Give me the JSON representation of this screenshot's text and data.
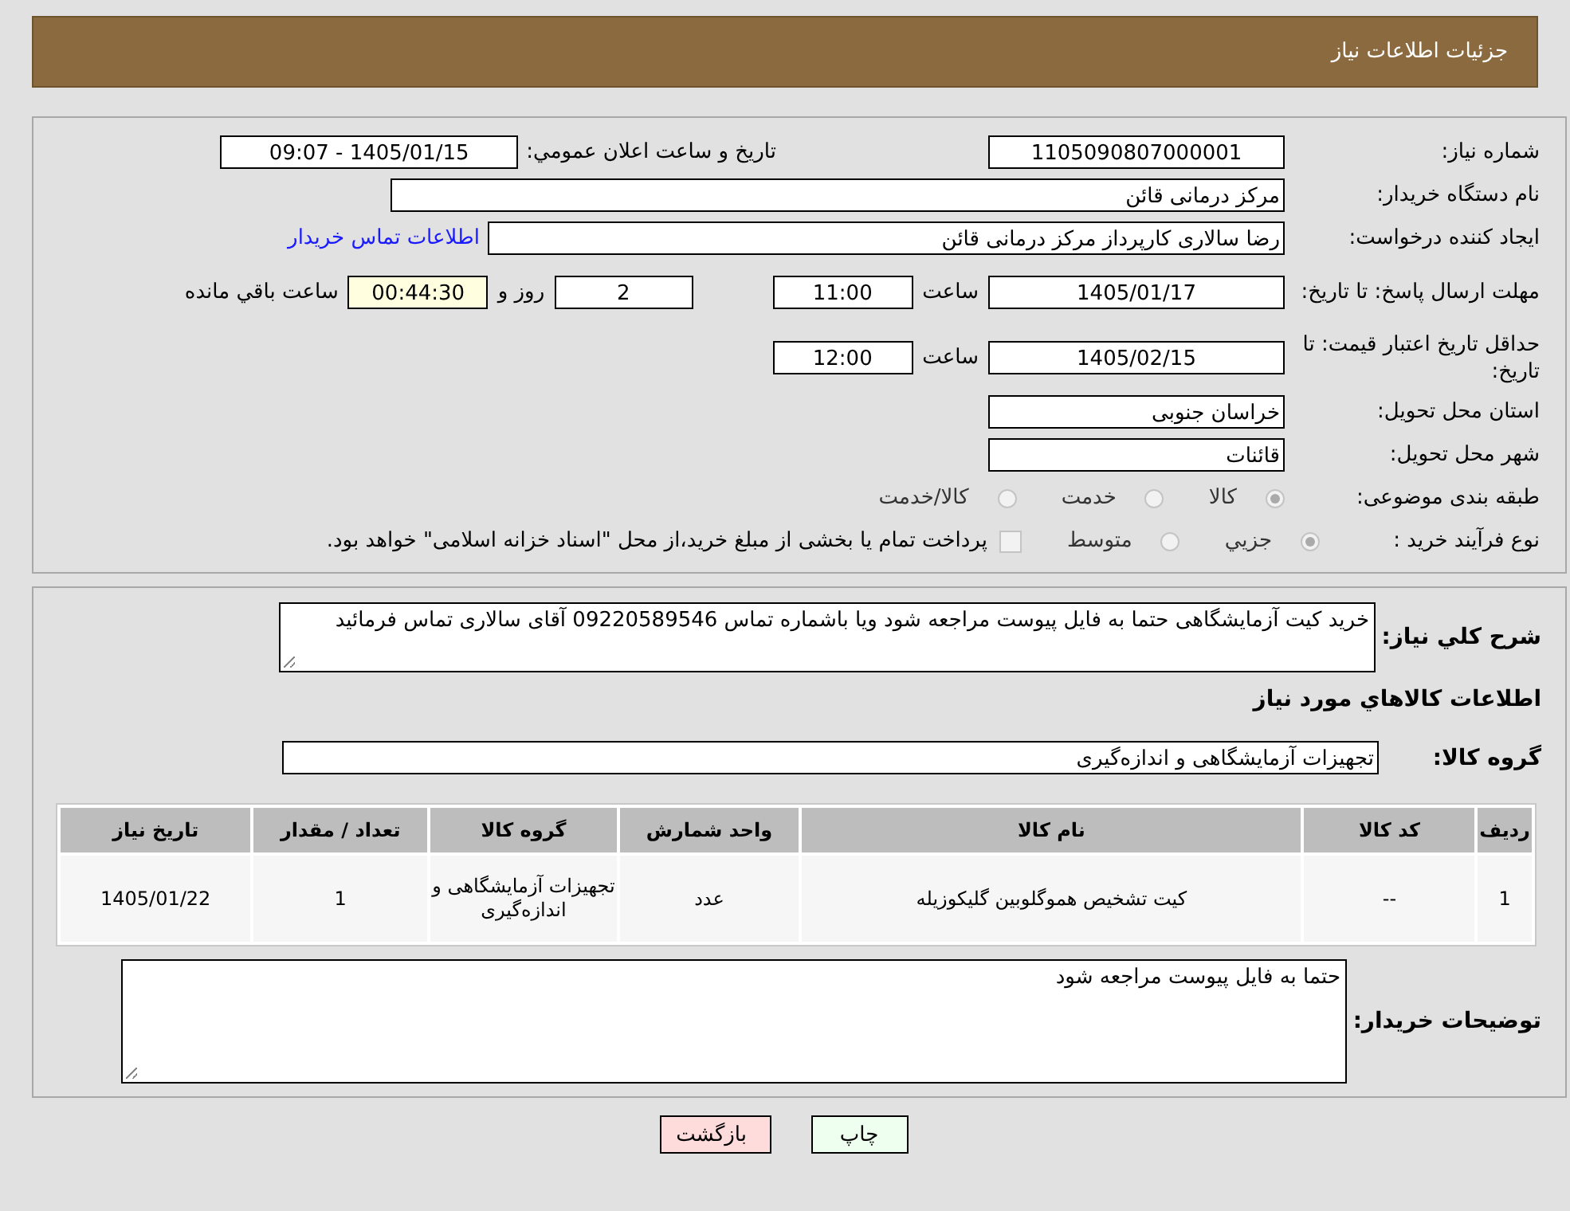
{
  "header": {
    "title": "جزئیات اطلاعات نیاز"
  },
  "details": {
    "need_number": {
      "label": "شماره نیاز:",
      "value": "1105090807000001"
    },
    "announce": {
      "label": "تاريخ و ساعت اعلان عمومي:",
      "value": "1405/01/15 - 09:07"
    },
    "buyer": {
      "label": "نام دستگاه خریدار:",
      "value": "مرکز درمانی قائن"
    },
    "creator": {
      "label": "ایجاد کننده درخواست:",
      "value": "رضا سالاری کارپرداز مرکز درمانی قائن",
      "link": "اطلاعات تماس خریدار"
    },
    "deadline": {
      "label": "مهلت ارسال پاسخ: تا تاریخ:",
      "date": "1405/01/17",
      "time_label": "ساعت",
      "time": "11:00",
      "days": "2",
      "days_label": "روز و",
      "remaining": "00:44:30",
      "remaining_label": "ساعت باقي مانده"
    },
    "validity": {
      "label": "حداقل تاریخ اعتبار قیمت: تا تاریخ:",
      "date": "1405/02/15",
      "time_label": "ساعت",
      "time": "12:00"
    },
    "province": {
      "label": "استان محل تحویل:",
      "value": "خراسان جنوبی"
    },
    "city": {
      "label": "شهر محل تحویل:",
      "value": "قائنات"
    },
    "category": {
      "label": "طبقه بندی موضوعی:",
      "options": [
        {
          "label": "کالا",
          "selected": true,
          "disabled": true
        },
        {
          "label": "خدمت",
          "selected": false,
          "disabled": true
        },
        {
          "label": "کالا/خدمت",
          "selected": false,
          "disabled": true
        }
      ]
    },
    "process": {
      "label": "نوع فرآیند خرید :",
      "options": [
        {
          "label": "جزيي",
          "selected": true,
          "disabled": true
        },
        {
          "label": "متوسط",
          "selected": false,
          "disabled": true
        }
      ],
      "treasury": {
        "label": "پرداخت تمام یا بخشی از مبلغ خرید،از محل \"اسناد خزانه اسلامی\" خواهد بود.",
        "checked": false,
        "disabled": true
      }
    }
  },
  "summary": {
    "label": "شرح کلي نیاز:",
    "value": "خرید کیت آزمایشگاهی حتما به فایل پیوست مراجعه شود ویا باشماره تماس 09220589546 آقای سالاری تماس فرمائید"
  },
  "goods_title": "اطلاعات کالاهاي مورد نیاز",
  "goods_group": {
    "label": "گروه کالا:",
    "value": "تجهیزات آزمایشگاهی و اندازه‌گیری"
  },
  "table": {
    "columns": [
      "ردیف",
      "کد کالا",
      "نام کالا",
      "واحد شمارش",
      "گروه کالا",
      "تعداد / مقدار",
      "تاریخ نیاز"
    ],
    "rows": [
      [
        "1",
        "--",
        "کیت تشخیص هموگلوبین گلیکوزیله",
        "عدد",
        "تجهیزات آزمایشگاهی و اندازه‌گیری",
        "1",
        "1405/01/22"
      ]
    ]
  },
  "notes": {
    "label": "توضیحات خریدار:",
    "value": "حتما به فایل پیوست مراجعه شود"
  },
  "buttons": [
    {
      "label": "چاپ",
      "kind": "print"
    },
    {
      "label": "بازگشت",
      "kind": "back"
    }
  ]
}
